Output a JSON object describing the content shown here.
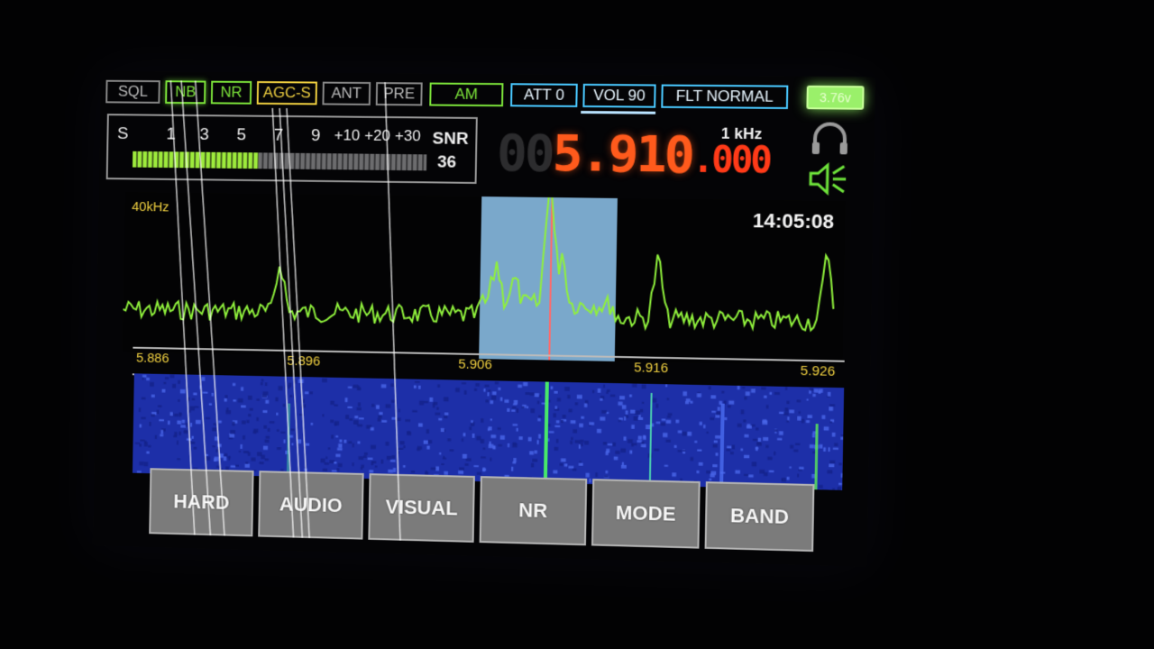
{
  "status_bar": {
    "sql": "SQL",
    "nb": "NB",
    "nr": "NR",
    "agc": "AGC-S",
    "ant": "ANT",
    "pre": "PRE",
    "mode": "AM",
    "att": "ATT 0",
    "vol": "VOL 90",
    "filter": "FLT NORMAL",
    "battery": "3.76v"
  },
  "s_meter": {
    "scale_labels": [
      "S",
      "1",
      "3",
      "5",
      "7",
      "9",
      "+10",
      "+20",
      "+30"
    ],
    "snr_label": "SNR",
    "snr_value": "36",
    "level": 0.43
  },
  "frequency": {
    "dim_digits": "00",
    "main_digits": "5.910",
    "sub_digits": ".000",
    "step": "1 kHz"
  },
  "spectrum": {
    "span": "40kHz",
    "time": "14:05:08",
    "scale_ticks": [
      "5.886",
      "5.896",
      "5.906",
      "5.916",
      "5.926"
    ]
  },
  "buttons": [
    "HARD",
    "AUDIO",
    "VISUAL",
    "NR",
    "MODE",
    "BAND"
  ],
  "colors": {
    "trace": "#8ff03c",
    "frequency": "#ff5a1c",
    "tick_label": "#f0d040",
    "passband": "#8fc6ee",
    "waterfall_bg": "#1d2fa8"
  },
  "icons": {
    "headphone": "headphone-icon",
    "speaker": "speaker-icon"
  }
}
